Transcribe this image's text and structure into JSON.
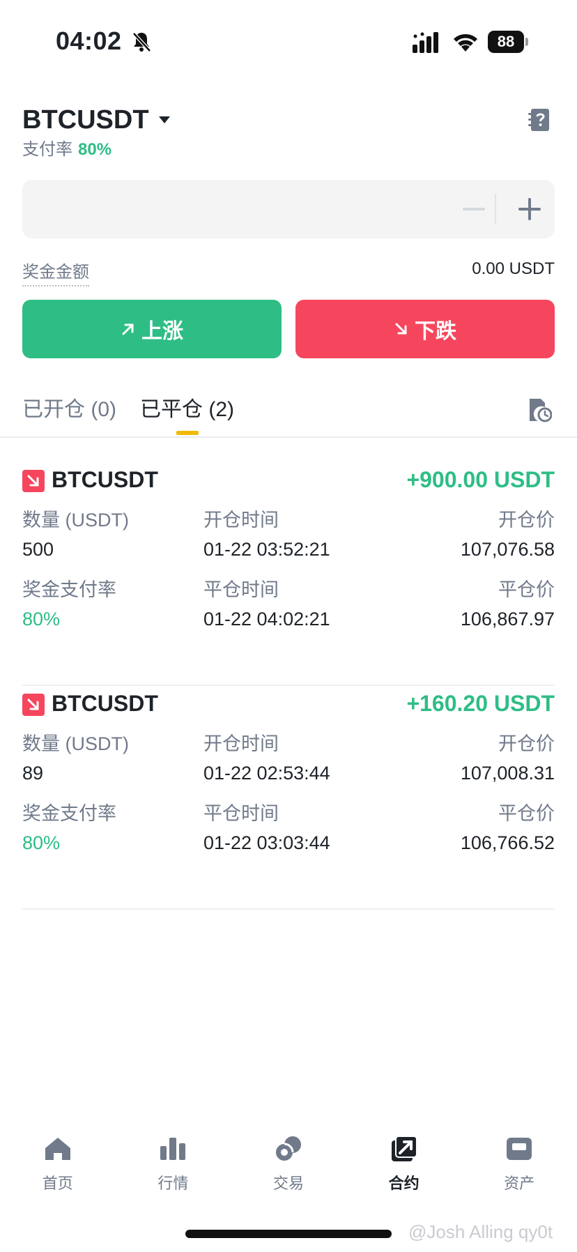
{
  "status_bar": {
    "time": "04:02",
    "battery": "88"
  },
  "header": {
    "pair": "BTCUSDT",
    "payout_label": "支付率",
    "payout_value": "80%"
  },
  "amount": {
    "value": "",
    "placeholder": ""
  },
  "bonus": {
    "label": "奖金金额",
    "value": "0.00 USDT"
  },
  "buttons": {
    "up": "上涨",
    "down": "下跌"
  },
  "tabs": [
    {
      "label": "已开仓 (0)"
    },
    {
      "label": "已平仓 (2)"
    }
  ],
  "positions": [
    {
      "symbol": "BTCUSDT",
      "pnl": "+900.00 USDT",
      "qty_label": "数量 (USDT)",
      "qty": "500",
      "open_time_label": "开仓时间",
      "open_time": "01-22 03:52:21",
      "open_price_label": "开仓价",
      "open_price": "107,076.58",
      "bonus_rate_label": "奖金支付率",
      "bonus_rate": "80%",
      "close_time_label": "平仓时间",
      "close_time": "01-22 04:02:21",
      "close_price_label": "平仓价",
      "close_price": "106,867.97"
    },
    {
      "symbol": "BTCUSDT",
      "pnl": "+160.20 USDT",
      "qty_label": "数量 (USDT)",
      "qty": "89",
      "open_time_label": "开仓时间",
      "open_time": "01-22 02:53:44",
      "open_price_label": "开仓价",
      "open_price": "107,008.31",
      "bonus_rate_label": "奖金支付率",
      "bonus_rate": "80%",
      "close_time_label": "平仓时间",
      "close_time": "01-22 03:03:44",
      "close_price_label": "平仓价",
      "close_price": "106,766.52"
    }
  ],
  "nav": [
    {
      "label": "首页",
      "icon": "home-icon"
    },
    {
      "label": "行情",
      "icon": "bar-chart-icon"
    },
    {
      "label": "交易",
      "icon": "trade-icon"
    },
    {
      "label": "合约",
      "icon": "futures-icon"
    },
    {
      "label": "资产",
      "icon": "wallet-icon"
    }
  ],
  "watermark": "@Josh Alling qy0t",
  "colors": {
    "up": "#2ebd85",
    "down": "#f6465d",
    "accent": "#f0b90b",
    "text": "#1e2329",
    "muted": "#707a8a"
  }
}
